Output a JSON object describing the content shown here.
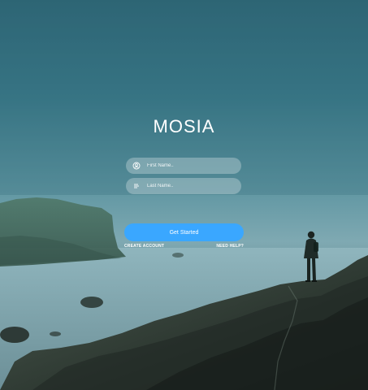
{
  "app": {
    "title": "MOSIA"
  },
  "form": {
    "first_name_placeholder": "First Name..",
    "last_name_placeholder": "Last Name..",
    "first_name_icon": "user-circle-icon",
    "last_name_icon": "text-lines-icon"
  },
  "actions": {
    "primary_button": "Get Started",
    "create_account": "CREATE ACCOUNT",
    "need_help": "NEED HELP?"
  },
  "colors": {
    "accent": "#3aa7ff",
    "overlay_field": "rgba(255,255,255,0.28)",
    "text": "#ffffff"
  }
}
